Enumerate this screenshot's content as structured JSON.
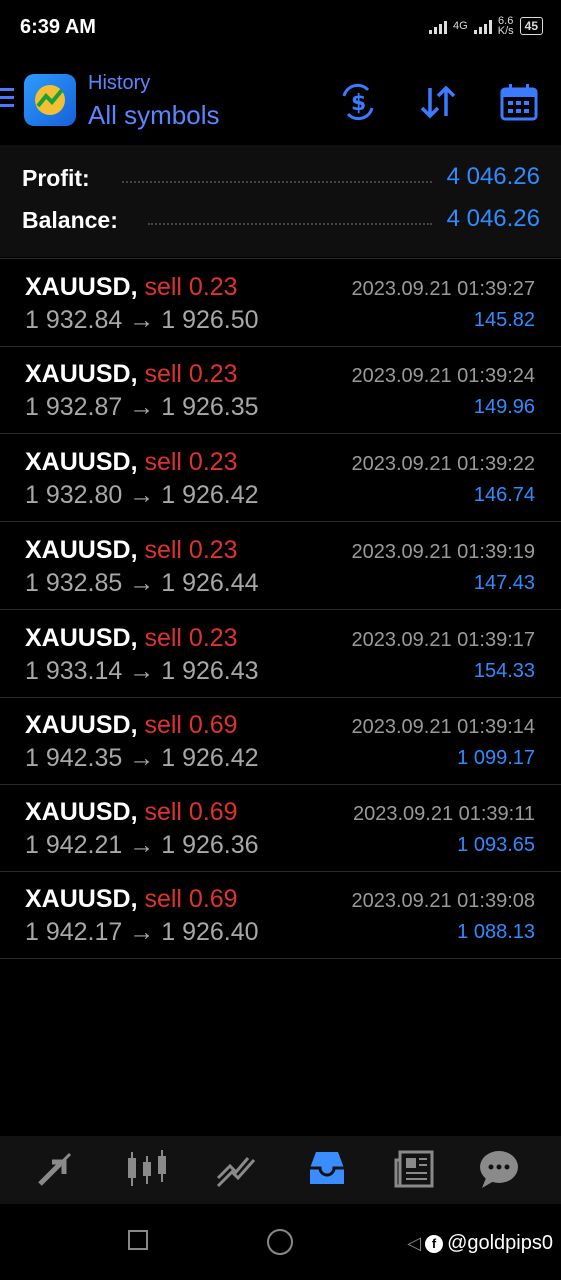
{
  "status": {
    "time": "6:39 AM",
    "network": "4G",
    "speed": "6.6",
    "speed_unit": "K/s",
    "battery": "45"
  },
  "header": {
    "subtitle": "History",
    "title": "All symbols"
  },
  "summary": {
    "profit_label": "Profit:",
    "profit_value": "4 046.26",
    "balance_label": "Balance:",
    "balance_value": "4 046.26"
  },
  "deals": [
    {
      "symbol": "XAUUSD,",
      "type": "sell 0.23",
      "open": "1 932.84",
      "arrow": "→",
      "close": "1 926.50",
      "time": "2023.09.21 01:39:27",
      "profit": "145.82"
    },
    {
      "symbol": "XAUUSD,",
      "type": "sell 0.23",
      "open": "1 932.87",
      "arrow": "→",
      "close": "1 926.35",
      "time": "2023.09.21 01:39:24",
      "profit": "149.96"
    },
    {
      "symbol": "XAUUSD,",
      "type": "sell 0.23",
      "open": "1 932.80",
      "arrow": "→",
      "close": "1 926.42",
      "time": "2023.09.21 01:39:22",
      "profit": "146.74"
    },
    {
      "symbol": "XAUUSD,",
      "type": "sell 0.23",
      "open": "1 932.85",
      "arrow": "→",
      "close": "1 926.44",
      "time": "2023.09.21 01:39:19",
      "profit": "147.43"
    },
    {
      "symbol": "XAUUSD,",
      "type": "sell 0.23",
      "open": "1 933.14",
      "arrow": "→",
      "close": "1 926.43",
      "time": "2023.09.21 01:39:17",
      "profit": "154.33"
    },
    {
      "symbol": "XAUUSD,",
      "type": "sell 0.69",
      "open": "1 942.35",
      "arrow": "→",
      "close": "1 926.42",
      "time": "2023.09.21 01:39:14",
      "profit": "1 099.17"
    },
    {
      "symbol": "XAUUSD,",
      "type": "sell 0.69",
      "open": "1 942.21",
      "arrow": "→",
      "close": "1 926.36",
      "time": "2023.09.21 01:39:11",
      "profit": "1 093.65"
    },
    {
      "symbol": "XAUUSD,",
      "type": "sell 0.69",
      "open": "1 942.17",
      "arrow": "→",
      "close": "1 926.40",
      "time": "2023.09.21 01:39:08",
      "profit": "1 088.13"
    }
  ],
  "bottom_nav": [
    {
      "icon": "trade-icon"
    },
    {
      "icon": "chart-icon"
    },
    {
      "icon": "trend-icon"
    },
    {
      "icon": "history-icon",
      "active": true
    },
    {
      "icon": "news-icon"
    },
    {
      "icon": "chat-icon"
    }
  ],
  "watermark": "@goldpips0",
  "colors": {
    "accent": "#2e8cff",
    "header_blue": "#5a86ff",
    "sell": "#e0322b",
    "muted": "#a8a8a8"
  }
}
